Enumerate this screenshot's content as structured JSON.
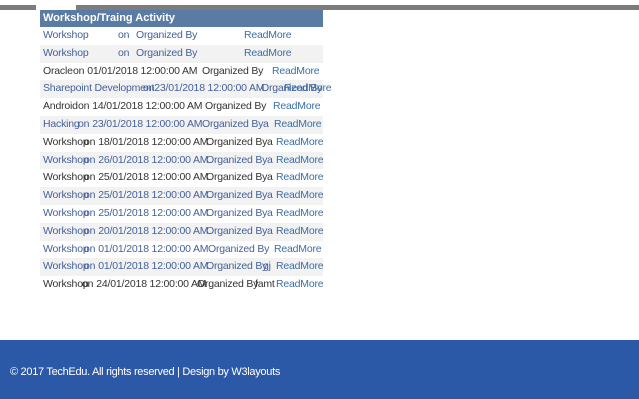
{
  "table": {
    "title": "Workshop/Traing Activity",
    "rows": [
      {
        "name": "Workshop",
        "on": "on",
        "date": "",
        "organized": "Organized By",
        "by": "",
        "readmore": "ReadMore",
        "style": "blue"
      },
      {
        "name": "Workshop",
        "on": "on",
        "date": "",
        "organized": "Organized By",
        "by": "",
        "readmore": "ReadMore",
        "style": "blue"
      },
      {
        "name": "Oracle",
        "on": "on",
        "date": "01/01/2018 12:00:00 AM",
        "organized": "Organized By",
        "by": "",
        "readmore": "ReadMore",
        "style": "dark"
      },
      {
        "name": "Sharepoint Development",
        "on": "on",
        "date": "23/01/2018 12:00:00 AM",
        "organized": "Organized By",
        "by": "",
        "readmore": "ReadMore",
        "style": "blue"
      },
      {
        "name": "Android",
        "on": "on",
        "date": "14/01/2018 12:00:00 AM",
        "organized": "Organized By",
        "by": "",
        "readmore": "ReadMore",
        "style": "dark"
      },
      {
        "name": "Hacking",
        "on": "on",
        "date": "23/01/2018 12:00:00 AM",
        "organized": "Organized By",
        "by": "a",
        "readmore": "ReadMore",
        "style": "blue"
      },
      {
        "name": "Workshop",
        "on": "on",
        "date": "18/01/2018 12:00:00 AM",
        "organized": "Organized By",
        "by": "a",
        "readmore": "ReadMore",
        "style": "dark"
      },
      {
        "name": "Workshop",
        "on": "on",
        "date": "26/01/2018 12:00:00 AM",
        "organized": "Organized By",
        "by": "a",
        "readmore": "ReadMore",
        "style": "blue"
      },
      {
        "name": "Workshop",
        "on": "on",
        "date": "25/01/2018 12:00:00 AM",
        "organized": "Organized By",
        "by": "a",
        "readmore": "ReadMore",
        "style": "dark"
      },
      {
        "name": "Workshop",
        "on": "on",
        "date": "25/01/2018 12:00:00 AM",
        "organized": "Organized By",
        "by": "a",
        "readmore": "ReadMore",
        "style": "blue"
      },
      {
        "name": "Workshop",
        "on": "on",
        "date": "25/01/2018 12:00:00 AM",
        "organized": "Organized By",
        "by": "a",
        "readmore": "ReadMore",
        "style": "blue"
      },
      {
        "name": "Workshop",
        "on": "on",
        "date": "20/01/2018 12:00:00 AM",
        "organized": "Organized By",
        "by": "a",
        "readmore": "ReadMore",
        "style": "blue"
      },
      {
        "name": "Workshop",
        "on": "on",
        "date": "01/01/2018 12:00:00 AM",
        "organized": "Organized By",
        "by": "",
        "readmore": "ReadMore",
        "style": "blue"
      },
      {
        "name": "Workshop",
        "on": "on",
        "date": "01/01/2018 12:00:00 AM",
        "organized": "Organized By",
        "by": "gj",
        "readmore": "ReadMore",
        "style": "blue"
      },
      {
        "name": "Workshop",
        "on": "on",
        "date": "24/01/2018 12:00:00 AM",
        "organized": "Organized By",
        "by": "famt",
        "readmore": "ReadMore",
        "style": "dark"
      }
    ]
  },
  "footer": {
    "text": "© 2017 TechEdu. All rights reserved | Design by W3layouts"
  },
  "colors": {
    "header_bg": "#5a7ba4",
    "footer_bg": "#2c58a8",
    "link": "#3a6fa6"
  }
}
